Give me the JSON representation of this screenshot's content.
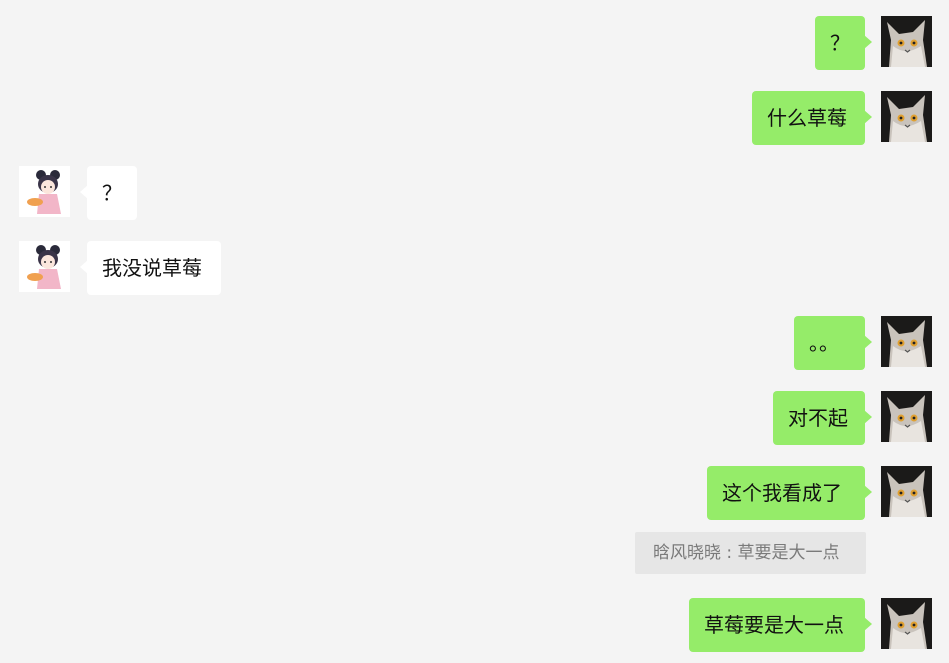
{
  "messages": [
    {
      "sender": "me",
      "text": "？"
    },
    {
      "sender": "me",
      "text": "什么草莓"
    },
    {
      "sender": "other",
      "text": "？"
    },
    {
      "sender": "other",
      "text": "我没说草莓"
    },
    {
      "sender": "me",
      "text": "。。"
    },
    {
      "sender": "me",
      "text": "对不起"
    },
    {
      "sender": "me",
      "text": "这个我看成了"
    },
    {
      "sender": "me",
      "text": "草莓要是大一点",
      "quote": "晗风晓晓 : 草要是大一点"
    }
  ],
  "colors": {
    "background": "#f4f4f4",
    "my_bubble": "#95ec69",
    "their_bubble": "#ffffff",
    "quote_bg": "#e6e6e6",
    "quote_text": "#7a7a7a"
  },
  "icons": {
    "me_avatar": "cat-avatar-icon",
    "other_avatar": "anime-girl-avatar-icon"
  }
}
